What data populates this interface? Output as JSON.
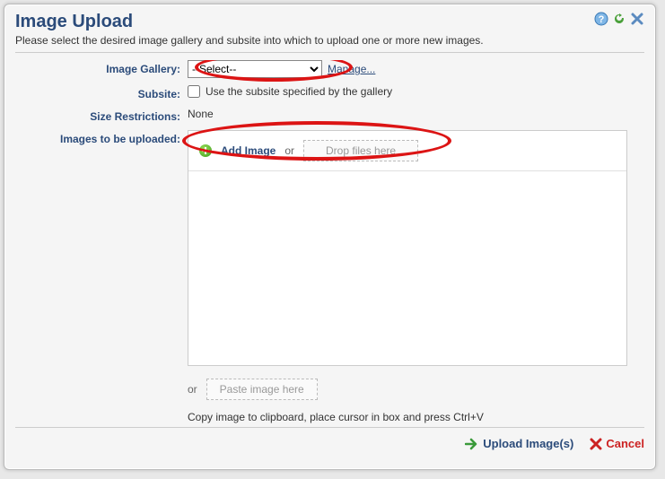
{
  "header": {
    "title": "Image Upload",
    "subtitle": "Please select the desired image gallery and subsite into which to upload one or more new images."
  },
  "icons": {
    "help": "help-icon",
    "refresh": "refresh-icon",
    "close": "close-icon"
  },
  "form": {
    "gallery_label": "Image Gallery:",
    "gallery_selected": "--Select--",
    "gallery_options": [
      "--Select--"
    ],
    "manage_link": "Manage...",
    "subsite_label": "Subsite:",
    "subsite_checkbox_text": "Use the subsite specified by the gallery",
    "subsite_checked": false,
    "size_label": "Size Restrictions:",
    "size_value": "None",
    "upload_label": "Images to be uploaded:",
    "add_image_text": "Add Image",
    "or_text": "or",
    "drop_text": "Drop files here",
    "paste_text": "Paste image here",
    "paste_hint": "Copy image to clipboard, place cursor in box and press Ctrl+V"
  },
  "footer": {
    "upload_label": "Upload Image(s)",
    "cancel_label": "Cancel"
  }
}
